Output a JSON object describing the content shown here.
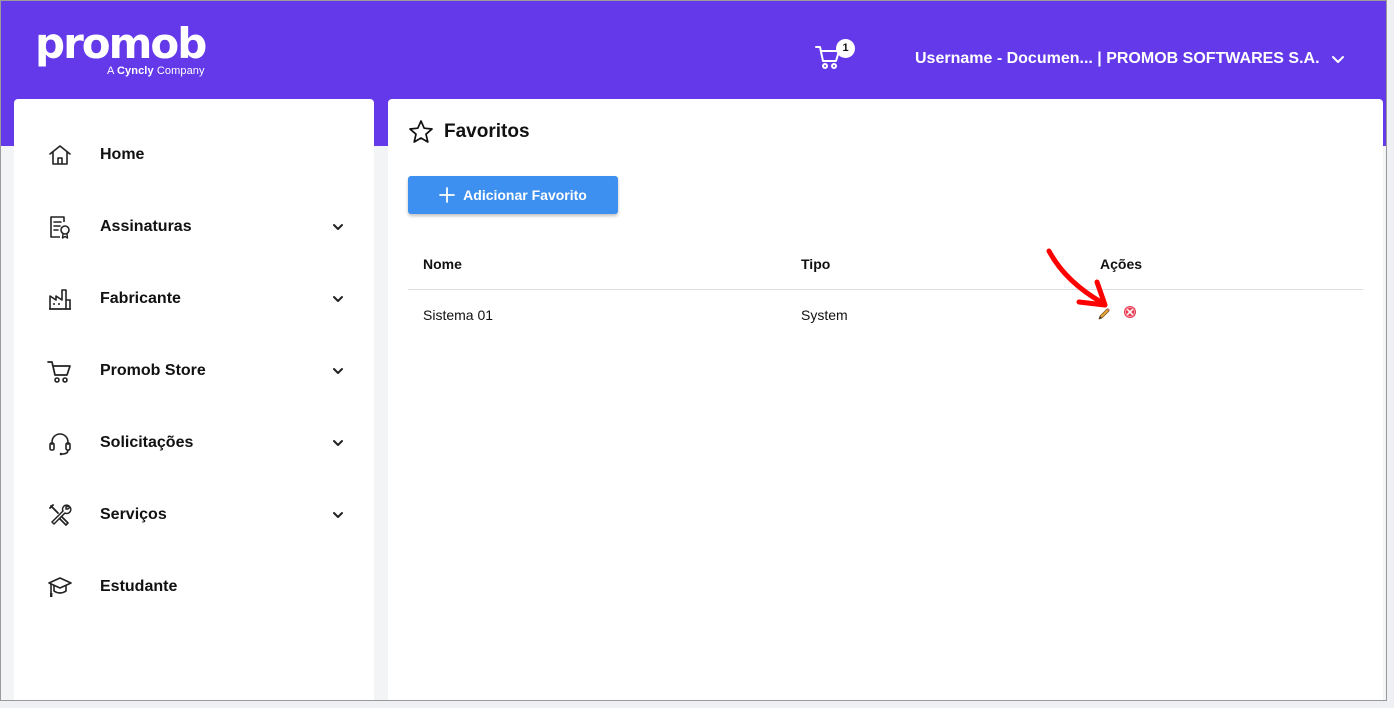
{
  "header": {
    "logo_text": "promob",
    "logo_tagline_prefix": "A",
    "logo_tagline_brand": "Cyncly",
    "logo_tagline_suffix": "Company",
    "cart_count": "1",
    "user_label": "Username - Documen... | PROMOB SOFTWARES S.A."
  },
  "sidebar": {
    "items": [
      {
        "label": "Home",
        "icon": "home-icon",
        "has_children": false
      },
      {
        "label": "Assinaturas",
        "icon": "document-badge-icon",
        "has_children": true
      },
      {
        "label": "Fabricante",
        "icon": "factory-icon",
        "has_children": true
      },
      {
        "label": "Promob Store",
        "icon": "cart-icon",
        "has_children": true
      },
      {
        "label": "Solicitações",
        "icon": "headset-icon",
        "has_children": true
      },
      {
        "label": "Serviços",
        "icon": "tools-icon",
        "has_children": true
      },
      {
        "label": "Estudante",
        "icon": "graduation-cap-icon",
        "has_children": false
      }
    ]
  },
  "main": {
    "title": "Favoritos",
    "add_button_label": "Adicionar Favorito",
    "table": {
      "columns": [
        "Nome",
        "Tipo",
        "Ações"
      ],
      "rows": [
        {
          "nome": "Sistema 01",
          "tipo": "System"
        }
      ]
    }
  },
  "colors": {
    "header_bg": "#6439e9",
    "primary_button": "#3d8ff0",
    "annotation_arrow": "#ff0000",
    "delete_icon": "#e53950"
  }
}
